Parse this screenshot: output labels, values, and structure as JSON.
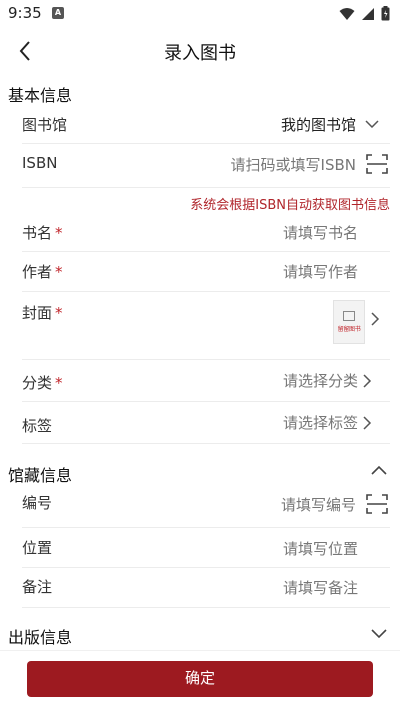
{
  "status": {
    "time": "9:35",
    "notif_badge": "A"
  },
  "nav": {
    "title": "录入图书"
  },
  "basic": {
    "header": "基本信息",
    "library": {
      "label": "图书馆",
      "value": "我的图书馆"
    },
    "isbn": {
      "label": "ISBN",
      "placeholder": "请扫码或填写ISBN"
    },
    "hint": "系统会根据ISBN自动获取图书信息",
    "title": {
      "label": "书名",
      "placeholder": "请填写书名"
    },
    "author": {
      "label": "作者",
      "placeholder": "请填写作者"
    },
    "cover": {
      "label": "封面"
    },
    "category": {
      "label": "分类",
      "placeholder": "请选择分类"
    },
    "tags": {
      "label": "标签",
      "placeholder": "请选择标签"
    },
    "required_mark": "*"
  },
  "collection": {
    "header": "馆藏信息",
    "number": {
      "label": "编号",
      "placeholder": "请填写编号"
    },
    "location": {
      "label": "位置",
      "placeholder": "请填写位置"
    },
    "note": {
      "label": "备注",
      "placeholder": "请填写备注"
    }
  },
  "publish": {
    "header": "出版信息"
  },
  "actions": {
    "confirm": "确定"
  },
  "colors": {
    "accent": "#9d1a20",
    "hint": "#b0252b"
  },
  "cover_thumb": {
    "text": "留留图书"
  }
}
